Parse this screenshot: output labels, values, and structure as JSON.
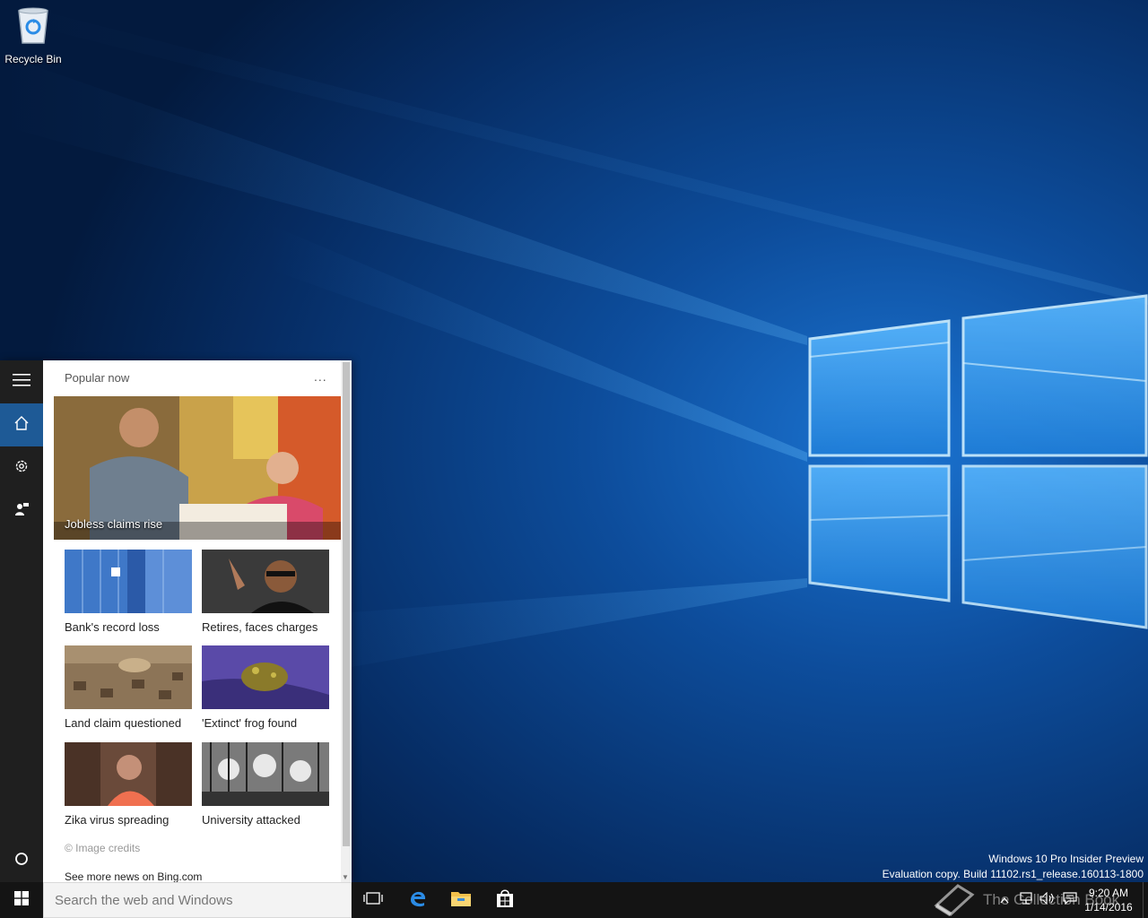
{
  "desktop": {
    "recycle_bin_label": "Recycle Bin",
    "watermark_line1": "Windows 10 Pro Insider Preview",
    "watermark_line2": "Evaluation copy. Build 11102.rs1_release.160113-1800"
  },
  "cortana": {
    "rail": {
      "menu_icon": "hamburger-icon",
      "home_icon": "home-icon",
      "settings_icon": "gear-icon",
      "feedback_icon": "feedback-icon",
      "cortana_icon": "circle-icon"
    },
    "section_title": "Popular now",
    "more_options": "...",
    "hero": {
      "caption": "Jobless claims rise"
    },
    "tiles": [
      {
        "caption": "Bank's record loss"
      },
      {
        "caption": "Retires, faces charges"
      },
      {
        "caption": "Land claim questioned"
      },
      {
        "caption": "'Extinct' frog found"
      },
      {
        "caption": "Zika virus spreading"
      },
      {
        "caption": "University attacked"
      }
    ],
    "image_credits": "© Image credits",
    "see_more": "See more news on Bing.com"
  },
  "taskbar": {
    "search_placeholder": "Search the web and Windows",
    "pinned": [
      {
        "name": "task-view-icon"
      },
      {
        "name": "edge-icon"
      },
      {
        "name": "file-explorer-icon"
      },
      {
        "name": "store-icon"
      }
    ],
    "overlay_text": "The Collection Book",
    "clock_time": "9:20 AM",
    "clock_date": "1/14/2016"
  },
  "colors": {
    "accent": "#1e5a96",
    "rail_bg": "#1f1f1f",
    "taskbar_bg": "#141414",
    "wallpaper_glow": "#5fc1ff"
  }
}
